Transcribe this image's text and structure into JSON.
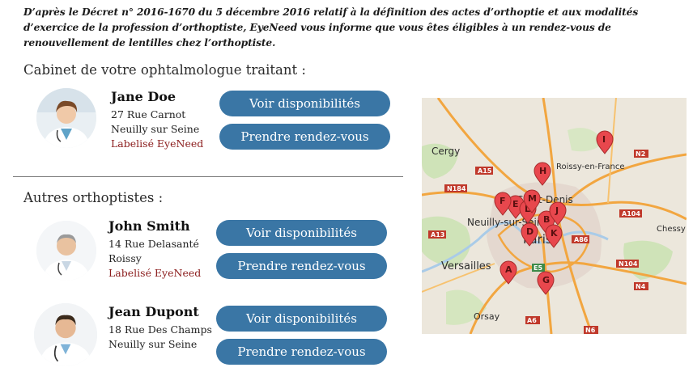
{
  "notice": "D’après le Décret n° 2016-1670 du 5 décembre 2016 relatif à la définition des actes d’orthoptie et aux modalités d’exercice de la profession d’orthoptiste, EyeNeed vous informe que vous êtes éligibles à un rendez-vous de renouvellement de lentilles chez l’orthoptiste.",
  "sections": {
    "main_title": "Cabinet de votre ophtalmologue traitant :",
    "others_title": "Autres orthoptistes :"
  },
  "buttons": {
    "availability": "Voir disponibilités",
    "book": "Prendre rendez-vous"
  },
  "doctors": [
    {
      "name": "Jane Doe",
      "address": "27 Rue Carnot",
      "city": "Neuilly sur Seine",
      "label": "Labelisé EyeNeed"
    },
    {
      "name": "John Smith",
      "address": "14 Rue Delasanté",
      "city": "Roissy",
      "label": "Labelisé EyeNeed"
    },
    {
      "name": "Jean Dupont",
      "address": "18 Rue Des Champs",
      "city": "Neuilly sur Seine"
    }
  ],
  "map": {
    "places": [
      "Cergy",
      "Roissy-en-France",
      "Neuilly-sur-Seine",
      "Saint-Denis",
      "Paris",
      "Versailles",
      "Orsay",
      "Chessy"
    ],
    "roads": [
      "N2",
      "A15",
      "N184",
      "A104",
      "A13",
      "A86",
      "N104",
      "N4",
      "A6",
      "E5",
      "N6"
    ],
    "pins": [
      "A",
      "B",
      "D",
      "E",
      "F",
      "G",
      "H",
      "I",
      "J",
      "K",
      "L",
      "M"
    ],
    "colors": {
      "pin": "#e8474d",
      "road_major": "#f2a640",
      "road_label": "#c0392b"
    }
  }
}
